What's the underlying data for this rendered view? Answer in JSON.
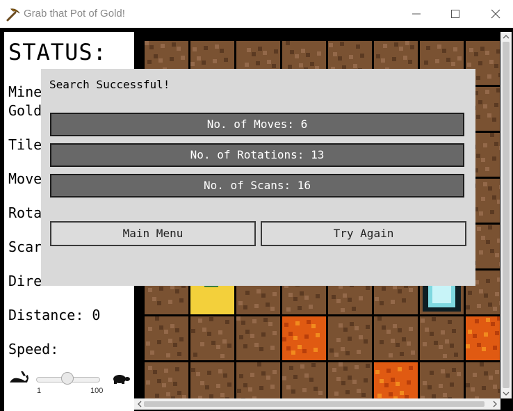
{
  "window": {
    "title": "Grab that Pot of Gold!",
    "icon": "pickaxe-icon",
    "controls": [
      "minimize-icon",
      "maximize-icon",
      "close-icon"
    ]
  },
  "status_panel": {
    "heading": "STATUS:",
    "miner_line1": "Mine",
    "miner_line2": "Gold",
    "tile": "Tile:",
    "moves": "Move",
    "rotations": "Rota",
    "scans": "Scar",
    "direction": "Dire",
    "distance": "Distance: 0",
    "speed_label": "Speed:",
    "speed_slider": {
      "min": "1",
      "max": "100",
      "value": 50,
      "slow_icon": "rabbit-icon",
      "fast_icon": "turtle-icon"
    }
  },
  "board": {
    "tile_legend": {
      "D": "dirt",
      "L": "lava",
      "G": "gold-miner",
      "B": "beacon"
    },
    "rows": [
      [
        "D",
        "D",
        "D",
        "D",
        "D",
        "D",
        "D",
        "D"
      ],
      [
        "D",
        "D",
        "D",
        "D",
        "D",
        "D",
        "D",
        "D"
      ],
      [
        "D",
        "D",
        "D",
        "D",
        "D",
        "D",
        "D",
        "D"
      ],
      [
        "D",
        "D",
        "D",
        "D",
        "D",
        "D",
        "D",
        "D"
      ],
      [
        "D",
        "D",
        "D",
        "D",
        "D",
        "D",
        "D",
        "D"
      ],
      [
        "D",
        "G",
        "D",
        "D",
        "D",
        "D",
        "B",
        "D"
      ],
      [
        "D",
        "D",
        "D",
        "L",
        "D",
        "D",
        "D",
        "L"
      ],
      [
        "D",
        "D",
        "D",
        "D",
        "D",
        "L",
        "D",
        "D"
      ]
    ],
    "colors": {
      "dirt": "#7a5232",
      "lava": "#e05a12",
      "gold": "#f3d03b",
      "beacon": "#7fd8e0"
    }
  },
  "dialog": {
    "message": "Search Successful!",
    "moves": "No. of Moves: 6",
    "rotations": "No. of Rotations: 13",
    "scans": "No. of Scans: 16",
    "main_menu": "Main Menu",
    "try_again": "Try Again"
  }
}
